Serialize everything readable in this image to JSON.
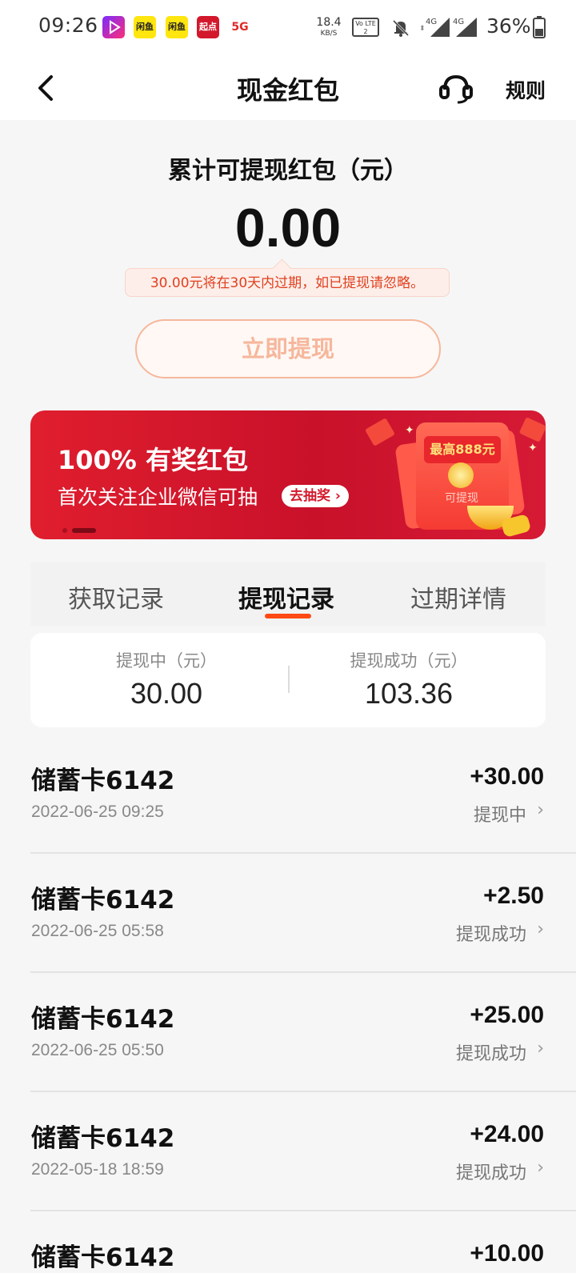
{
  "status_bar": {
    "time": "09:26",
    "apps": [
      "video-app-icon",
      "xianyu-icon",
      "xianyu-icon",
      "qidian-icon",
      "5g-icon"
    ],
    "app_labels": [
      "闲鱼",
      "闲鱼",
      "起点",
      "5G"
    ],
    "net_speed": "18.4",
    "net_unit": "KB/S",
    "volte": "Vo LTE 2",
    "sig1": "4G",
    "sig2": "4G",
    "battery": "36%"
  },
  "nav": {
    "title": "现金红包",
    "rules": "规则"
  },
  "balance": {
    "label": "累计可提现红包（元）",
    "amount": "0.00",
    "expire_note": "30.00元将在30天内过期，如已提现请忽略。",
    "withdraw_button": "立即提现"
  },
  "banner": {
    "title": "100% 有奖红包",
    "subtitle": "首次关注企业微信可抽",
    "cta": "去抽奖",
    "packet_top": "最高888元",
    "packet_label": "可提现"
  },
  "tabs": [
    "获取记录",
    "提现记录",
    "过期详情"
  ],
  "active_tab": 1,
  "summary": {
    "pending_label": "提现中（元）",
    "pending_value": "30.00",
    "success_label": "提现成功（元）",
    "success_value": "103.36"
  },
  "records": [
    {
      "title": "储蓄卡6142",
      "time": "2022-06-25 09:25",
      "amount": "+30.00",
      "status": "提现中"
    },
    {
      "title": "储蓄卡6142",
      "time": "2022-06-25 05:58",
      "amount": "+2.50",
      "status": "提现成功"
    },
    {
      "title": "储蓄卡6142",
      "time": "2022-06-25 05:50",
      "amount": "+25.00",
      "status": "提现成功"
    },
    {
      "title": "储蓄卡6142",
      "time": "2022-05-18 18:59",
      "amount": "+24.00",
      "status": "提现成功"
    },
    {
      "title": "储蓄卡6142",
      "time": "",
      "amount": "+10.00",
      "status": ""
    }
  ],
  "colors": {
    "accent": "#ff4a14",
    "banner_red": "#d31a2c",
    "button_outline": "#f6b79c",
    "note_text": "#e0401f"
  }
}
